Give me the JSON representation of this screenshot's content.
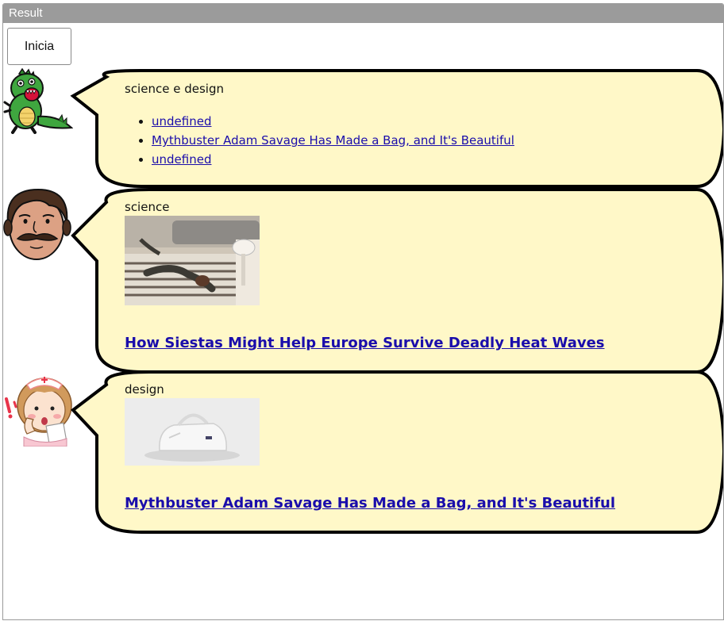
{
  "frame": {
    "title": "Result"
  },
  "start_button": {
    "label": "Inicia"
  },
  "messages": [
    {
      "avatar": "green-dinosaur",
      "topic": "science e design",
      "links": [
        "undefined",
        "Mythbuster Adam Savage Has Made a Bag, and It's Beautiful",
        "undefined"
      ]
    },
    {
      "avatar": "mustached-man",
      "topic": "science",
      "image": "person-lying-on-bed-photo",
      "headline": "How Siestas Might Help Europe Survive Deadly Heat Waves"
    },
    {
      "avatar": "nurse-with-clipboard",
      "topic": "design",
      "image": "white-bag-photo",
      "headline": "Mythbuster Adam Savage Has Made a Bag, and It's Beautiful"
    }
  ],
  "colors": {
    "bubble_fill": "#fff8c8",
    "bubble_stroke": "#000000",
    "link": "#1a0dab",
    "header_bg": "#9b9b9b"
  }
}
